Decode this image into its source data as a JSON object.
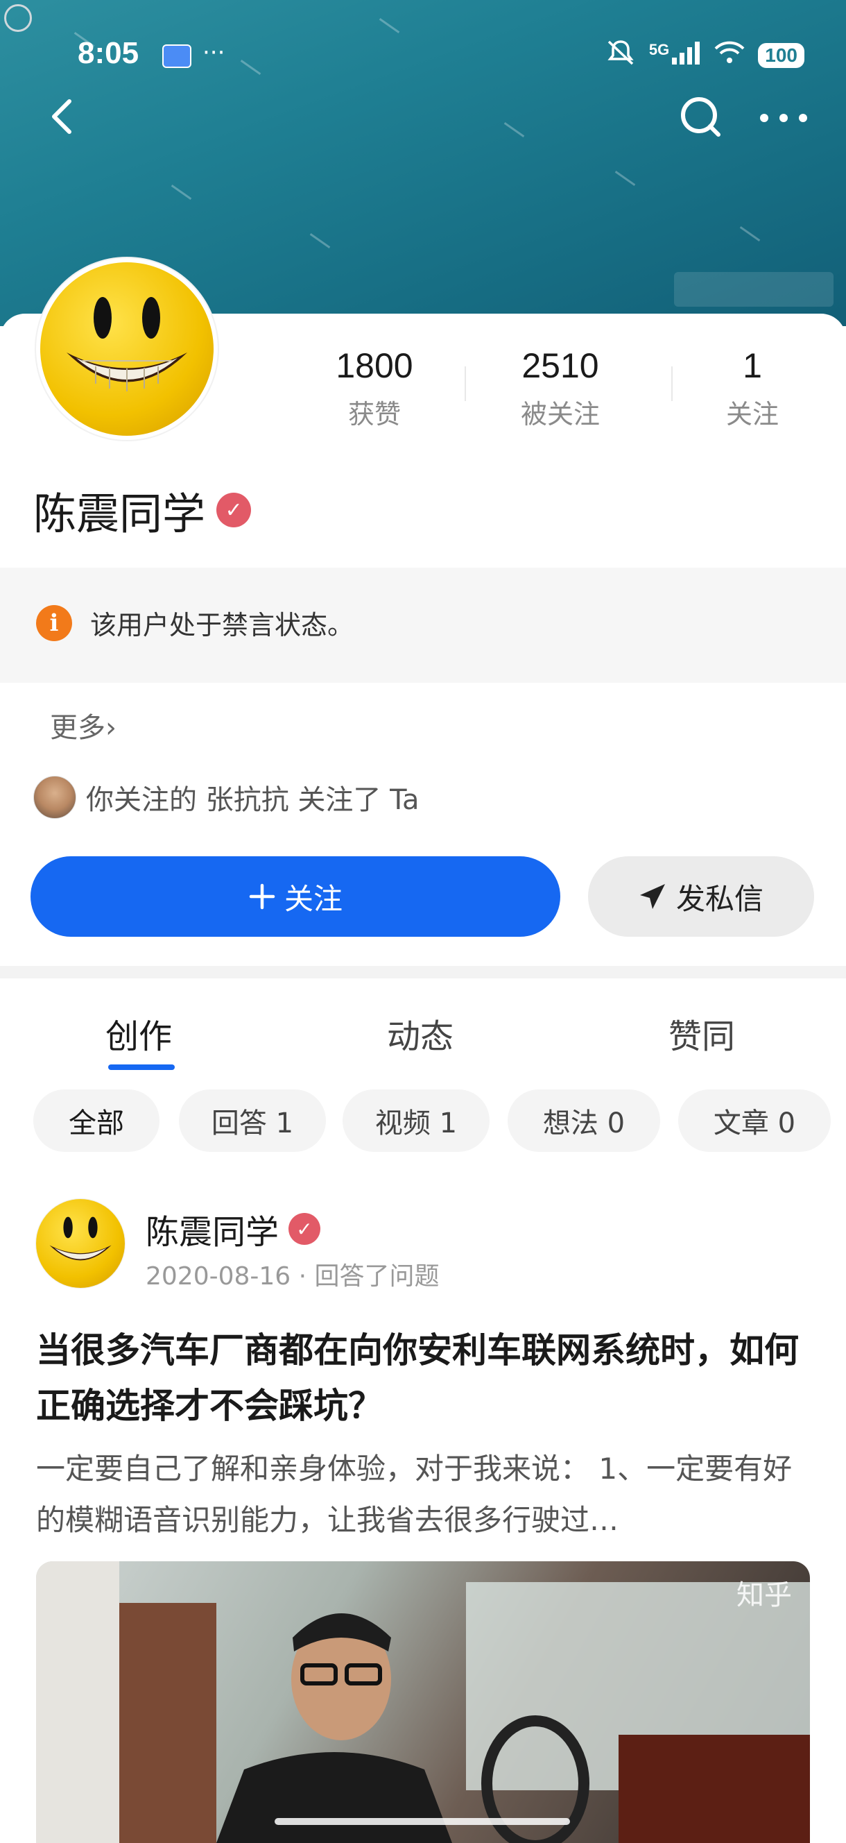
{
  "status_bar": {
    "time": "8:05",
    "dots": "···",
    "network": "5G",
    "battery": "100"
  },
  "profile": {
    "name": "陈震同学",
    "stats": [
      {
        "value": "1800",
        "label": "获赞"
      },
      {
        "value": "2510",
        "label": "被关注"
      },
      {
        "value": "1",
        "label": "关注"
      }
    ],
    "notice": "该用户处于禁言状态。",
    "more_label": "更多›",
    "followed_by": "你关注的 张抗抗 关注了 Ta"
  },
  "actions": {
    "follow_label": "关注",
    "message_label": "发私信"
  },
  "tabs": [
    {
      "label": "创作",
      "active": true
    },
    {
      "label": "动态",
      "active": false
    },
    {
      "label": "赞同",
      "active": false
    }
  ],
  "filters": [
    {
      "label": "全部",
      "active": true
    },
    {
      "label": "回答 1",
      "active": false
    },
    {
      "label": "视频 1",
      "active": false
    },
    {
      "label": "想法 0",
      "active": false
    },
    {
      "label": "文章 0",
      "active": false
    }
  ],
  "post": {
    "author": "陈震同学",
    "meta": "2020-08-16 · 回答了问题",
    "title": "当很多汽车厂商都在向你安利车联网系统时，如何正确选择才不会踩坑？",
    "excerpt": "一定要自己了解和亲身体验，对于我来说： 1、一定要有好的模糊语音识别能力，让我省去很多行驶过…",
    "image_watermark": "知乎"
  },
  "colors": {
    "accent": "#1668f2",
    "header_teal": "#1f7f93",
    "verify_badge": "#e25a67",
    "info_orange": "#f27a1a"
  },
  "icons": [
    "back-arrow-icon",
    "search-icon",
    "more-dots-icon",
    "verified-badge-icon",
    "info-icon",
    "plus-icon",
    "send-paper-plane-icon"
  ]
}
